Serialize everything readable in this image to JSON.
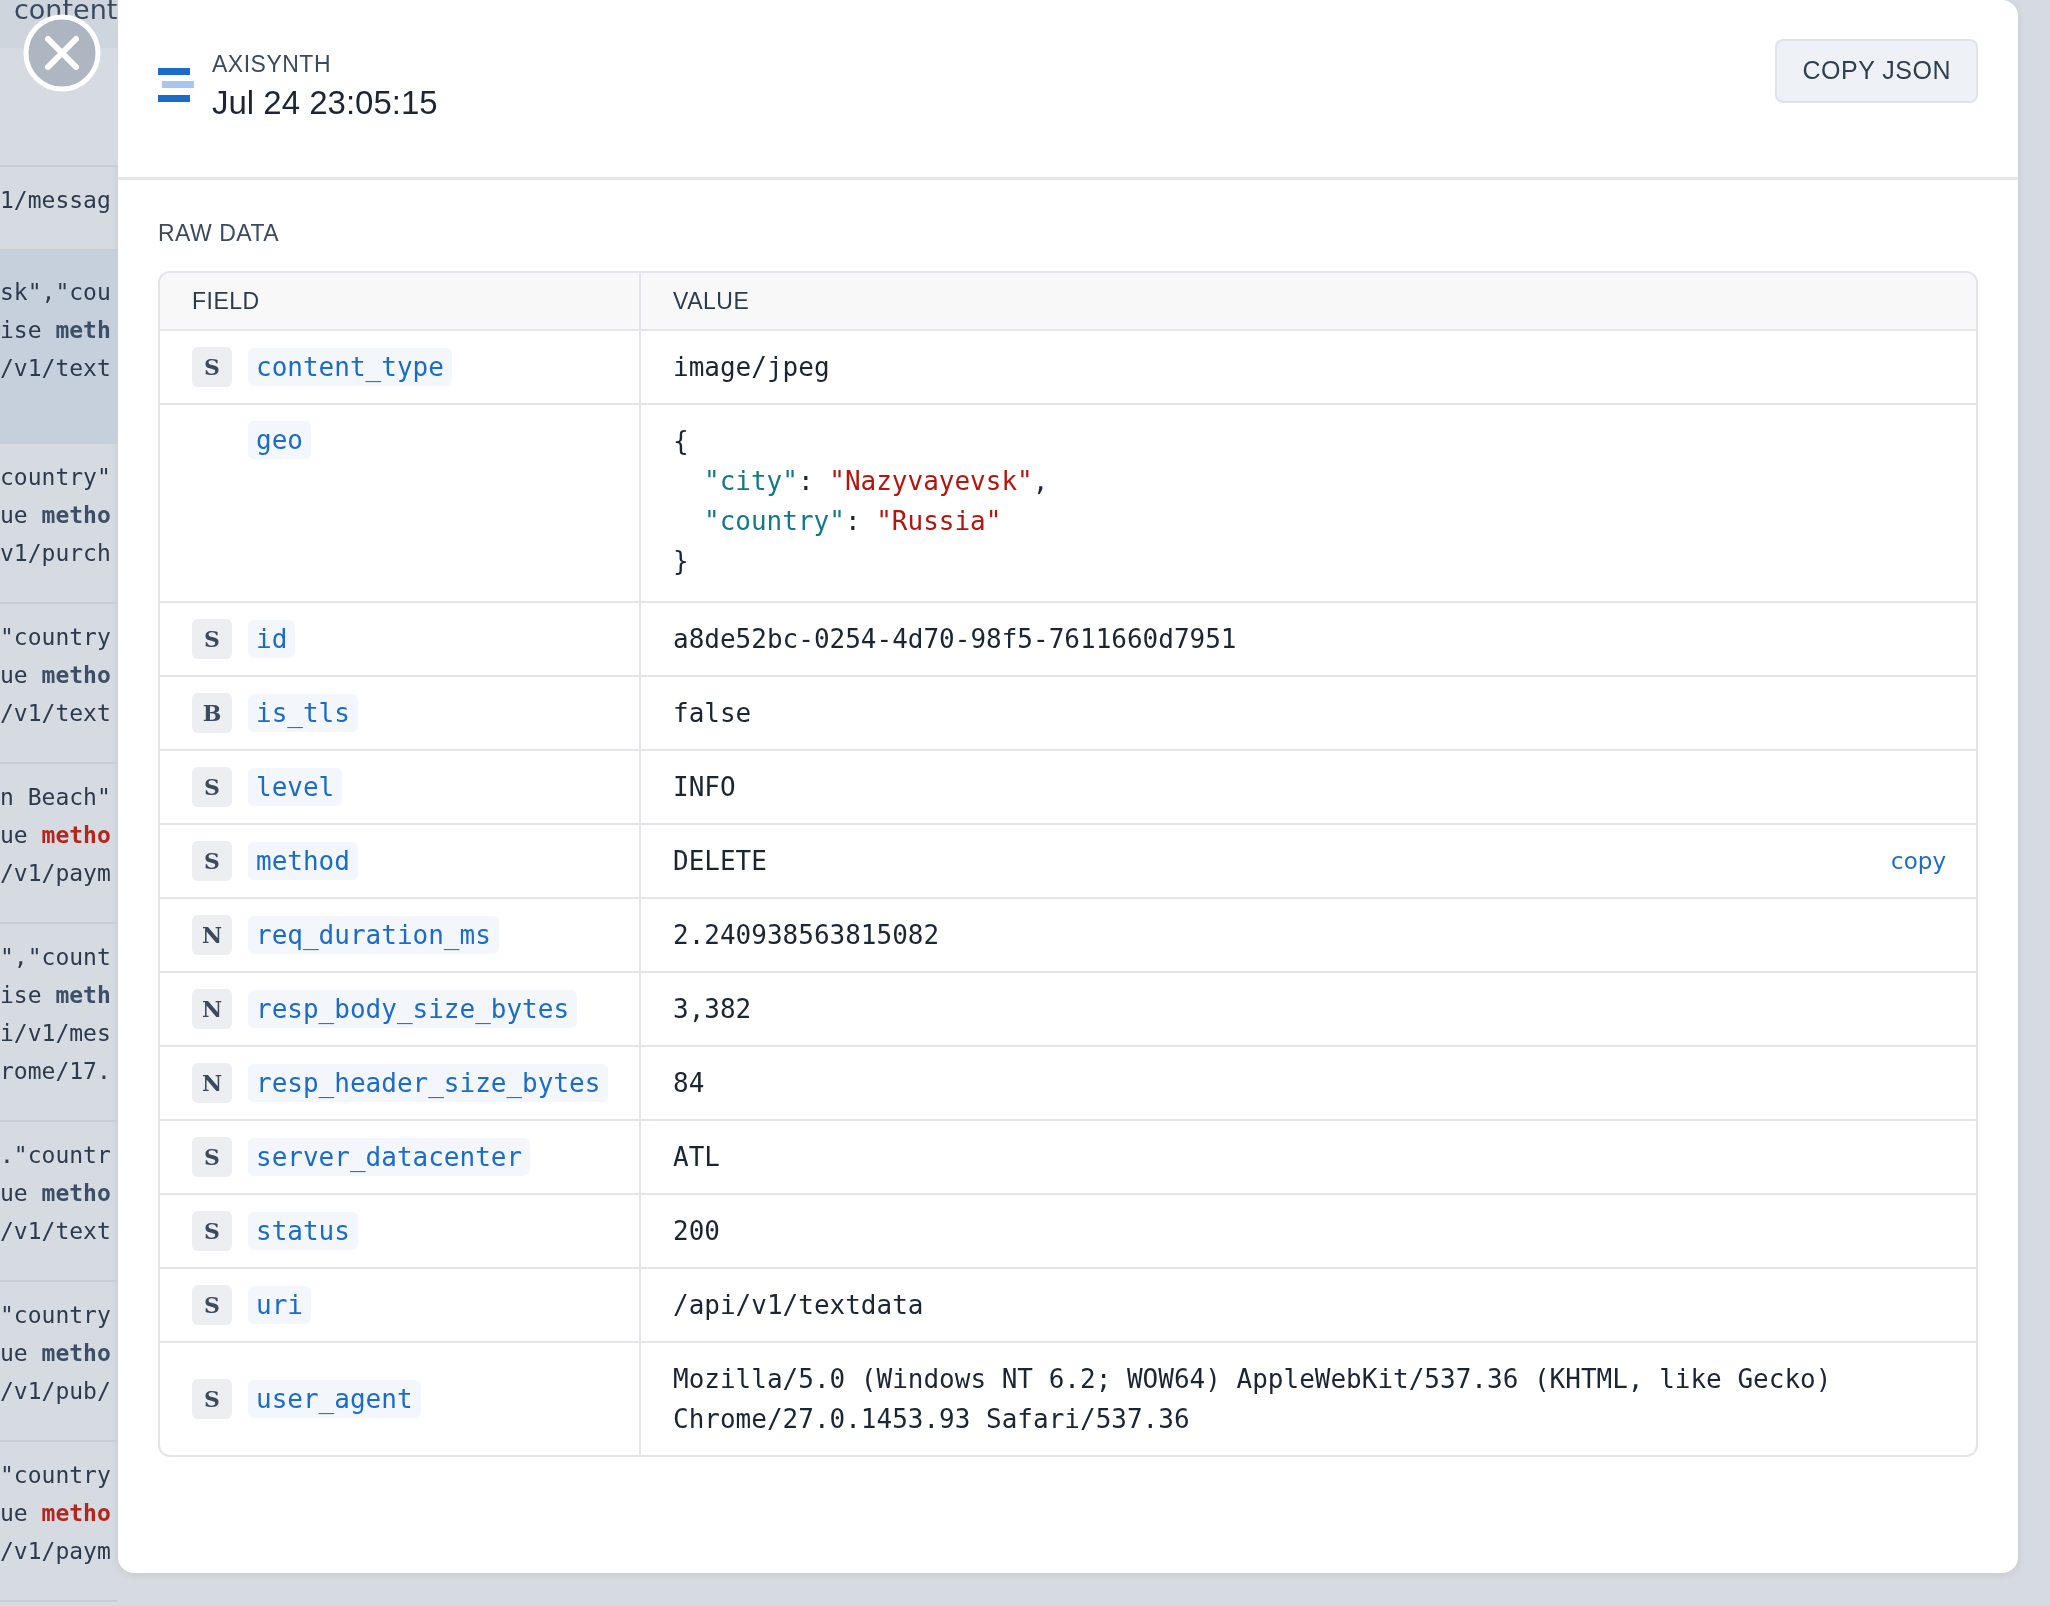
{
  "background": {
    "top_text": "content",
    "rows": [
      {
        "selected": false,
        "lines": [
          "1/messag"
        ]
      },
      {
        "selected": true,
        "error": false,
        "lines": [
          "sk\",\"cou",
          "ise **meth**",
          "/v1/text"
        ]
      },
      {
        "selected": false,
        "error": false,
        "lines": [
          "country\"",
          "ue **metho**",
          "v1/purch"
        ]
      },
      {
        "selected": false,
        "error": false,
        "lines": [
          "\"country",
          "ue **metho**",
          "/v1/text"
        ]
      },
      {
        "selected": false,
        "error": true,
        "lines": [
          "n Beach\"",
          "ue **metho**",
          "/v1/paym"
        ]
      },
      {
        "selected": false,
        "error": false,
        "lines": [
          "\",\"count",
          "ise **meth**",
          "i/v1/mes",
          "rome/17."
        ]
      },
      {
        "selected": false,
        "error": false,
        "lines": [
          ".\"countr",
          "ue **metho**",
          "/v1/text"
        ]
      },
      {
        "selected": false,
        "error": false,
        "lines": [
          "\"country",
          "ue **metho**",
          "/v1/pub/"
        ]
      },
      {
        "selected": false,
        "error": true,
        "lines": [
          "\"country",
          "ue **metho**",
          "/v1/paym"
        ]
      }
    ]
  },
  "panel": {
    "source": "AXISYNTH",
    "timestamp": "Jul 24 23:05:15",
    "copy_button": "COPY JSON",
    "section_title": "RAW DATA",
    "table": {
      "columns": [
        "FIELD",
        "VALUE"
      ],
      "rows": [
        {
          "type": "S",
          "field": "content_type",
          "kind": "text",
          "value": "image/jpeg"
        },
        {
          "field": "geo",
          "kind": "object",
          "open": "{",
          "close": "}",
          "entries": [
            {
              "key": "\"city\"",
              "sep": ": ",
              "value": "\"Nazyvayevsk\"",
              "end": ","
            },
            {
              "key": "\"country\"",
              "sep": ": ",
              "value": "\"Russia\""
            }
          ]
        },
        {
          "type": "S",
          "field": "id",
          "kind": "text",
          "value": "a8de52bc-0254-4d70-98f5-7611660d7951"
        },
        {
          "type": "B",
          "field": "is_tls",
          "kind": "text",
          "value": "false"
        },
        {
          "type": "S",
          "field": "level",
          "kind": "text",
          "value": "INFO"
        },
        {
          "type": "S",
          "field": "method",
          "kind": "text",
          "value": "DELETE",
          "action": "copy"
        },
        {
          "type": "N",
          "field": "req_duration_ms",
          "kind": "text",
          "value": "2.240938563815082"
        },
        {
          "type": "N",
          "field": "resp_body_size_bytes",
          "kind": "text",
          "value": "3,382"
        },
        {
          "type": "N",
          "field": "resp_header_size_bytes",
          "kind": "text",
          "value": "84"
        },
        {
          "type": "S",
          "field": "server_datacenter",
          "kind": "text",
          "value": "ATL"
        },
        {
          "type": "S",
          "field": "status",
          "kind": "text",
          "value": "200"
        },
        {
          "type": "S",
          "field": "uri",
          "kind": "text",
          "value": "/api/v1/textdata"
        },
        {
          "type": "S",
          "field": "user_agent",
          "kind": "text",
          "value": "Mozilla/5.0 (Windows NT 6.2; WOW64) AppleWebKit/537.36 (KHTML, like Gecko) Chrome/27.0.1453.93 Safari/537.36"
        }
      ]
    }
  }
}
